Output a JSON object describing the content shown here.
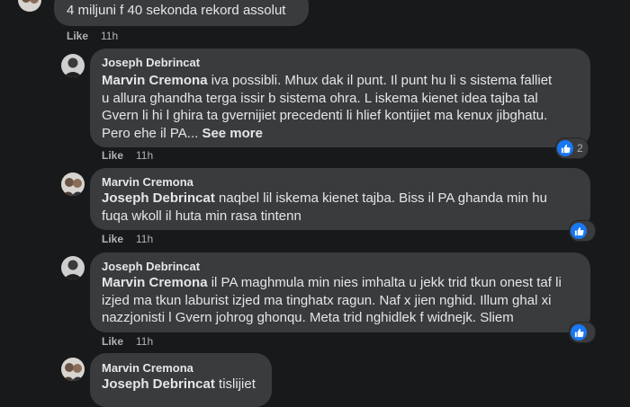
{
  "top_comment": {
    "text": "4 miljuni f 40 sekonda rekord assolut",
    "like_label": "Like",
    "time": "11h"
  },
  "replies": [
    {
      "author": "Joseph Debrincat",
      "mention": "Marvin Cremona",
      "lines": [
        " iva possibli. Mhux dak il punt. Il punt hu li s sistema falliet",
        "u allura ghandha terga issir b sistema ohra. L iskema kienet idea tajba tal",
        "Gvern li hi l ghira ta gvernijiet precedenti li hlief kontijiet ma kenux jibghatu.",
        "Pero ehe il PA... "
      ],
      "see_more": "See more",
      "like_label": "Like",
      "time": "11h",
      "reaction_count": "2"
    },
    {
      "author": "Marvin Cremona",
      "mention": "Joseph Debrincat",
      "lines": [
        " naqbel lil iskema kienet tajba. Biss il PA ghanda min hu",
        "fuqa wkoll il huta min rasa tintenn"
      ],
      "like_label": "Like",
      "time": "11h",
      "reaction_count": ""
    },
    {
      "author": "Joseph Debrincat",
      "mention": "Marvin Cremona",
      "lines": [
        " il PA maghmula min nies imhalta u jekk trid tkun onest taf li",
        "izjed ma tkun laburist izjed ma tinghatx ragun. Naf x jien nghid. Illum ghal xi",
        "nazzjonisti l Gvern johrog ghonqu. Meta trid nghidlek f widnejk. Sliem"
      ],
      "like_label": "Like",
      "time": "11h",
      "reaction_count": ""
    },
    {
      "author": "Marvin Cremona",
      "mention": "Joseph Debrincat",
      "lines": [
        " tislijiet"
      ],
      "reaction_count": ""
    }
  ]
}
